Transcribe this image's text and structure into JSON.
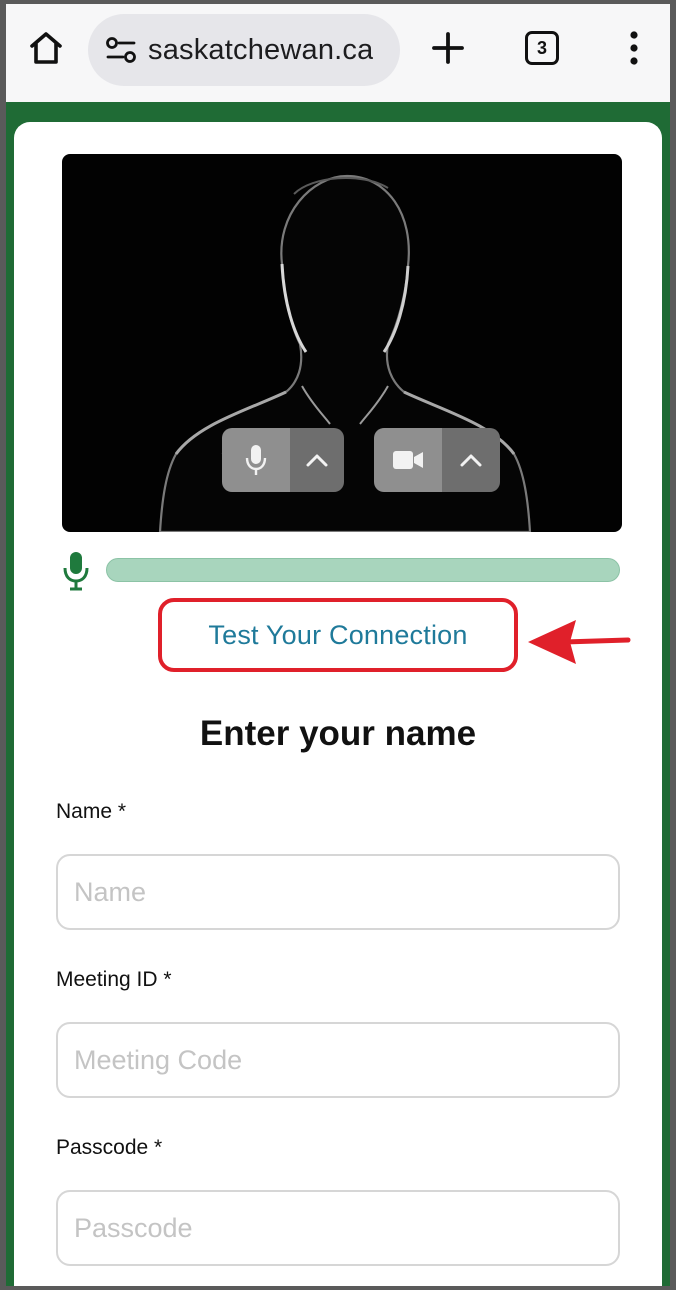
{
  "browser": {
    "url": "saskatchewan.ca",
    "tab_count": "3"
  },
  "page": {
    "test_connection_label": "Test Your Connection",
    "form_title": "Enter your name",
    "fields": [
      {
        "label": "Name *",
        "placeholder": "Name"
      },
      {
        "label": "Meeting ID *",
        "placeholder": "Meeting Code"
      },
      {
        "label": "Passcode *",
        "placeholder": "Passcode"
      }
    ]
  },
  "colors": {
    "brand_green": "#1f6b35",
    "link_teal": "#1f7a9a",
    "annotation_red": "#e0202a",
    "mic_level_track": "#a8d5bd"
  },
  "icons": {
    "home": "home-icon",
    "site_settings": "site-settings-icon",
    "new_tab": "plus-icon",
    "tabs": "tab-switcher-icon",
    "menu": "more-vertical-icon",
    "mic": "microphone-icon",
    "camera": "video-camera-icon",
    "chevron": "chevron-up-icon"
  }
}
